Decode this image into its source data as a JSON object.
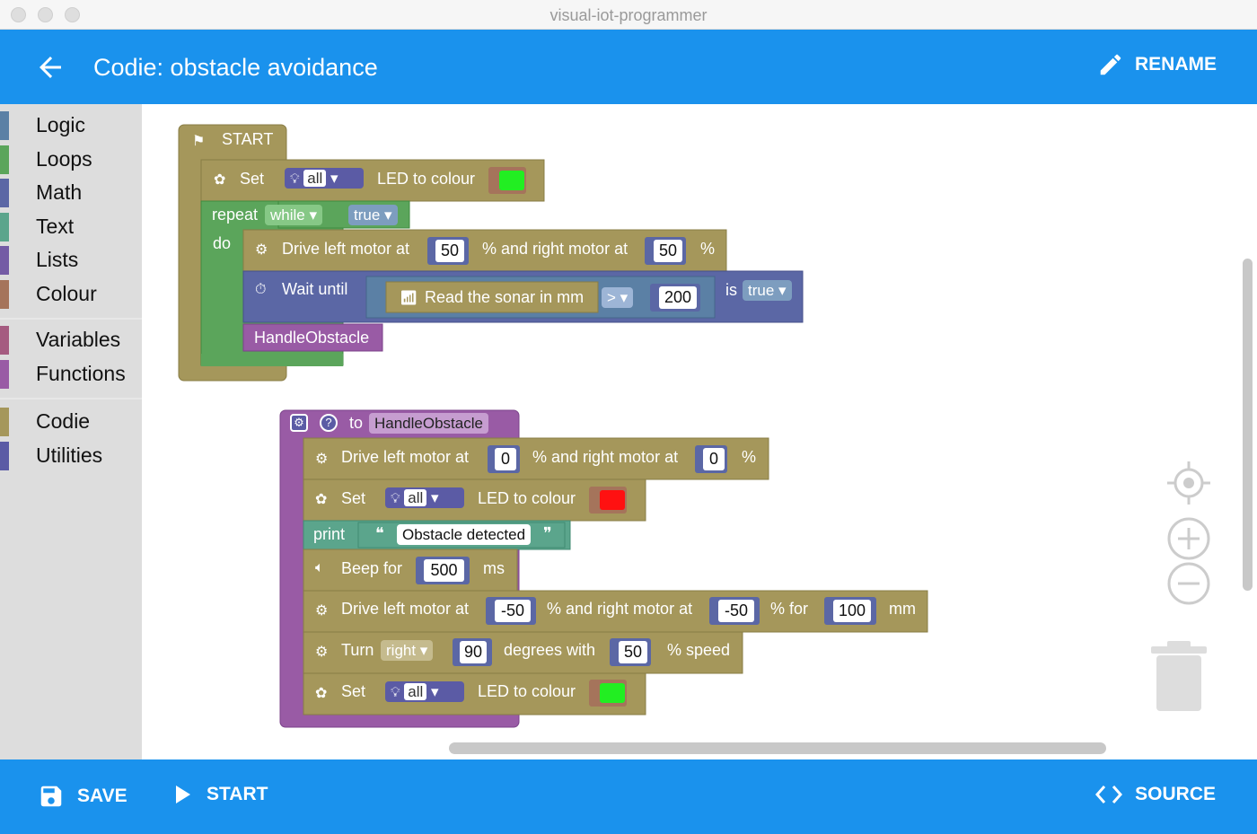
{
  "window": {
    "title": "visual-iot-programmer"
  },
  "header": {
    "title": "Codie: obstacle avoidance",
    "rename_label": "RENAME"
  },
  "sidebar": {
    "groups": [
      [
        {
          "label": "Logic",
          "color": "#5b80a5"
        },
        {
          "label": "Loops",
          "color": "#5ba55b"
        },
        {
          "label": "Math",
          "color": "#5b67a5"
        },
        {
          "label": "Text",
          "color": "#5ba58c"
        },
        {
          "label": "Lists",
          "color": "#745ba5"
        },
        {
          "label": "Colour",
          "color": "#a5745b"
        }
      ],
      [
        {
          "label": "Variables",
          "color": "#a55b80"
        },
        {
          "label": "Functions",
          "color": "#995ba5"
        }
      ],
      [
        {
          "label": "Codie",
          "color": "#a5975b"
        },
        {
          "label": "Utilities",
          "color": "#5b5ba5"
        }
      ]
    ]
  },
  "blocks": {
    "start": "START",
    "set": "Set",
    "all": "all",
    "led_to_colour": "LED to colour",
    "repeat": "repeat",
    "while": "while",
    "true": "true",
    "do": "do",
    "drive_left": "Drive left motor at",
    "and_right": "% and right motor at",
    "percent": "%",
    "v50": "50",
    "wait_until": "Wait until",
    "read_sonar": "Read the sonar in mm",
    "gt": ">",
    "v200": "200",
    "is": "is",
    "handle_obstacle": "HandleObstacle",
    "to": "to",
    "v0": "0",
    "print": "print",
    "obstacle_detected": "Obstacle detected",
    "beep_for": "Beep for",
    "v500": "500",
    "ms": "ms",
    "vneg50": "-50",
    "percent_for": "% for",
    "v100": "100",
    "mm": "mm",
    "turn": "Turn",
    "right": "right",
    "v90": "90",
    "degrees_with": "degrees with",
    "percent_speed": "% speed",
    "colour_green": "#22ee22",
    "colour_red": "#ff1111"
  },
  "footer": {
    "save_label": "SAVE",
    "start_label": "START",
    "source_label": "SOURCE"
  }
}
